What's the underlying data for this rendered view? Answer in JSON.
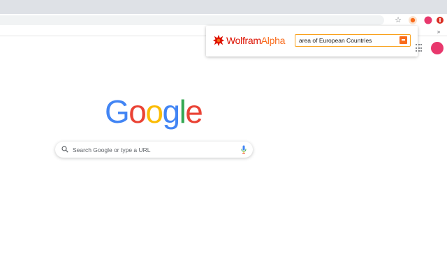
{
  "browser": {
    "icons": [
      "star-icon",
      "wolframalpha-extension-icon",
      "profile-extension-icon",
      "chrome-menu-icon",
      "chevron-down-icon"
    ]
  },
  "wolfram_popup": {
    "logo_part1": "Wolfram",
    "logo_part2": "Alpha",
    "query_value": "area of European Countries",
    "colors": {
      "brand_red": "#dd1100",
      "brand_orange": "#f96b1b",
      "border": "#f9a11b"
    }
  },
  "ntp": {
    "logo_letters": [
      "G",
      "o",
      "o",
      "g",
      "l",
      "e"
    ],
    "search_placeholder": "Search Google or type a URL",
    "colors": {
      "blue": "#4285f4",
      "red": "#ea4335",
      "yellow": "#fbbc05",
      "green": "#34a853",
      "avatar": "#e8386d"
    }
  }
}
